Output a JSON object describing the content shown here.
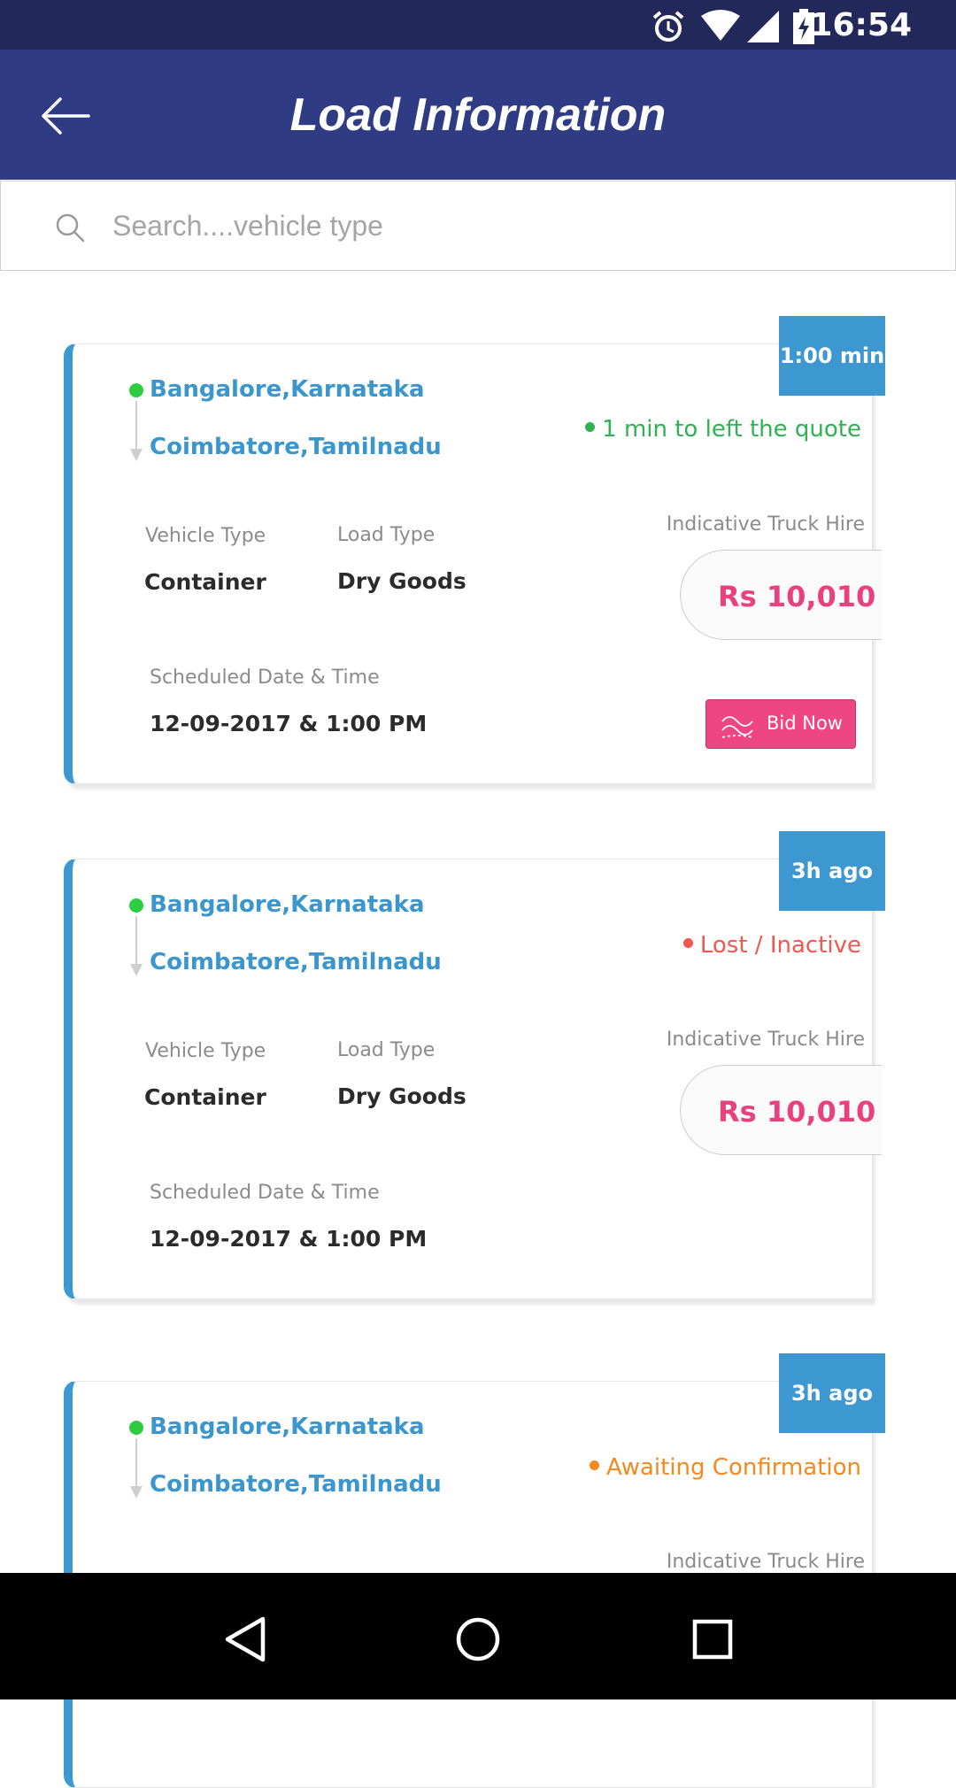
{
  "status_bar": {
    "time": "16:54"
  },
  "header": {
    "title": "Load Information"
  },
  "search": {
    "placeholder": "Search....vehicle type"
  },
  "loads": [
    {
      "badge": "1:00 min",
      "origin": "Bangalore,Karnataka",
      "destination": "Coimbatore,Tamilnadu",
      "status": "1 min to left the quote",
      "status_color": "#2fb352",
      "vehicle_type_label": "Vehicle Type",
      "vehicle_type": "Container",
      "load_type_label": "Load Type",
      "load_type": "Dry Goods",
      "hire_label": "Indicative Truck Hire",
      "price": "Rs 10,010",
      "schedule_label": "Scheduled Date & Time",
      "schedule": "12-09-2017 & 1:00 PM",
      "action_label": "Bid Now"
    },
    {
      "badge": "3h ago",
      "origin": "Bangalore,Karnataka",
      "destination": "Coimbatore,Tamilnadu",
      "status": "Lost / Inactive",
      "status_color": "#f0574f",
      "vehicle_type_label": "Vehicle Type",
      "vehicle_type": "Container",
      "load_type_label": "Load Type",
      "load_type": "Dry Goods",
      "hire_label": "Indicative Truck Hire",
      "price": "Rs 10,010",
      "schedule_label": "Scheduled Date & Time",
      "schedule": "12-09-2017 & 1:00 PM"
    },
    {
      "badge": "3h ago",
      "origin": "Bangalore,Karnataka",
      "destination": "Coimbatore,Tamilnadu",
      "status": "Awaiting Confirmation",
      "status_color": "#f4891f",
      "hire_label": "Indicative Truck Hire"
    }
  ],
  "nav": {
    "icons": [
      "back-triangle-icon",
      "home-circle-icon",
      "recents-square-icon"
    ]
  },
  "colors": {
    "appbar": "#2f3c83",
    "statusbar": "#22295a",
    "accent": "#3d98d2",
    "price": "#e9417d"
  }
}
